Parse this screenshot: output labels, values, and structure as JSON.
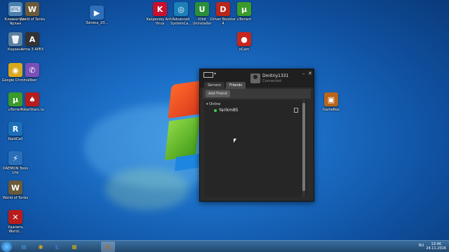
{
  "desktop": {
    "icons": [
      {
        "label": "Клавиатура Ярлык",
        "glyph": "⌨",
        "color": "#4a7fb0"
      },
      {
        "label": "World of Tanks",
        "glyph": "W",
        "color": "#6b5a3a"
      },
      {
        "label": "Запись_20...",
        "glyph": "▶",
        "color": "#2e6fb8"
      },
      {
        "label": "Kaspersky Anti-Virus",
        "glyph": "K",
        "color": "#c8102e"
      },
      {
        "label": "Advanced SystemCa...",
        "glyph": "◎",
        "color": "#1c7fb8"
      },
      {
        "label": "IObit Uninstaller",
        "glyph": "U",
        "color": "#2a8f3a"
      },
      {
        "label": "Driver Booster 4",
        "glyph": "D",
        "color": "#b8261c"
      },
      {
        "label": "uTorrent",
        "glyph": "μ",
        "color": "#3a9a2a"
      },
      {
        "label": "Корзина",
        "glyph": "🗑",
        "color": "#5a7fa0"
      },
      {
        "label": "Armа 3 APEX",
        "glyph": "A",
        "color": "#333333"
      },
      {
        "label": "oCam",
        "glyph": "●",
        "color": "#c8261c"
      },
      {
        "label": "Google Chrome",
        "glyph": "◉",
        "color": "#d9a81c"
      },
      {
        "label": "Viber",
        "glyph": "✆",
        "color": "#7b4fb8"
      },
      {
        "label": "uTorrent",
        "glyph": "μ",
        "color": "#3a9a2a"
      },
      {
        "label": "PokerStars.ru",
        "glyph": "♠",
        "color": "#b81c1c"
      },
      {
        "label": "GameBox",
        "glyph": "▣",
        "color": "#b8651c"
      },
      {
        "label": "RaidCall",
        "glyph": "R",
        "color": "#1c6fb8"
      },
      {
        "label": "DAEMON Tools Lite",
        "glyph": "⚡",
        "color": "#2a6fb8"
      },
      {
        "label": "World of Tanks",
        "glyph": "W",
        "color": "#6b5a3a"
      },
      {
        "label": "Удалить World...",
        "glyph": "✕",
        "color": "#b81c1c"
      }
    ]
  },
  "app": {
    "username": "Dmitriy1331",
    "status": "Connected",
    "tabs": [
      "Servers",
      "Friends"
    ],
    "add_friend_label": "Add Friend",
    "group_label": "Online",
    "friends": [
      {
        "name": "Yarikm85",
        "status_color": "#3ecf3e"
      }
    ],
    "minimize": "–",
    "close": "✕"
  },
  "taskbar": {
    "items": [
      {
        "glyph": "▤",
        "color": "#4a8fd0"
      },
      {
        "glyph": "◉",
        "color": "#d9a81c"
      },
      {
        "glyph": "◧",
        "color": "#3a6fb8"
      },
      {
        "glyph": "▦",
        "color": "#c8a81c"
      },
      {
        "glyph": "▭",
        "color": "#555555"
      },
      {
        "glyph": "◍",
        "color": "#b8651c"
      }
    ],
    "lang": "RU",
    "time": "13:46",
    "date": "24.11.2016"
  }
}
